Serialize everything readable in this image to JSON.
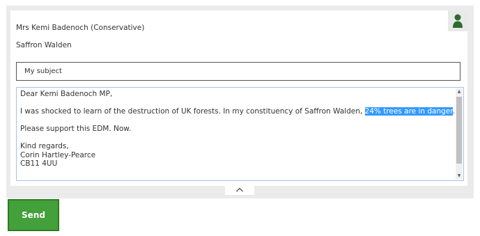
{
  "recipient": {
    "mp_name": "Mrs Kemi Badenoch (Conservative)",
    "constituency": "Saffron Walden",
    "avatar_icon": "person-icon"
  },
  "subject_field": {
    "value": "My subject"
  },
  "message": {
    "salutation": "Dear Kemi Badenoch MP,",
    "body_prefix": "I was shocked to learn of the destruction of UK forests. In my constituency of Saffron Walden, ",
    "body_highlight": "24% trees are in danger",
    "body_suffix": ".",
    "request": "Please support this EDM. Now.",
    "signoff": "Kind regards,",
    "sender_name": "Corin Hartley-Pearce",
    "sender_postcode": "CB11 4UU"
  },
  "collapse_icon": "chevron-up-icon",
  "send_label": "Send",
  "colors": {
    "send_button": "#44a03a",
    "highlight": "#3399ff",
    "avatar": "#2e6b2e"
  }
}
